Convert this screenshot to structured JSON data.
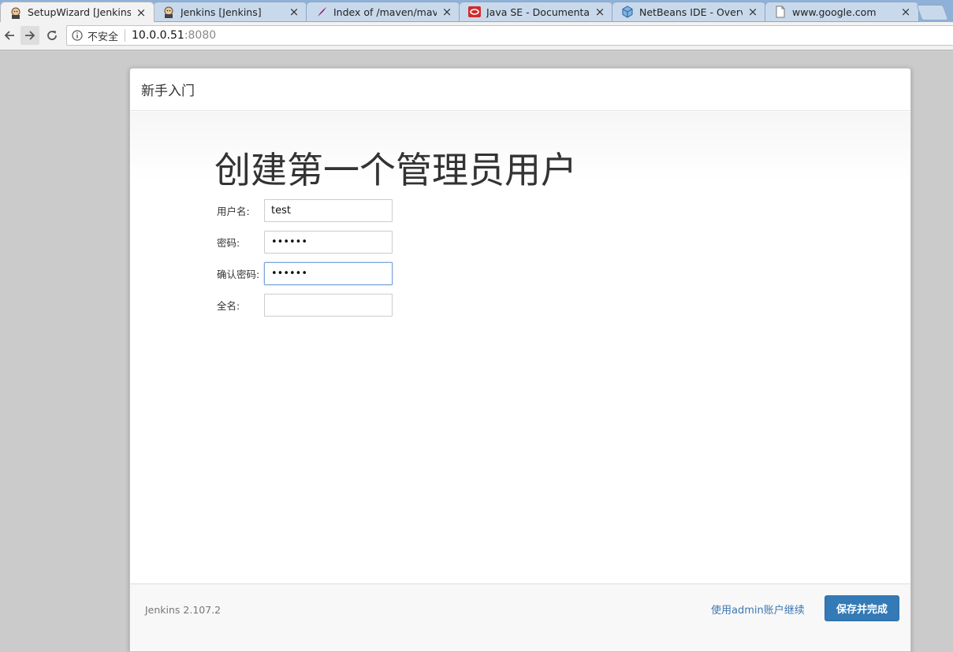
{
  "browser": {
    "tabs": [
      {
        "title": "SetupWizard [Jenkins]",
        "icon": "jenkins-icon",
        "active": true
      },
      {
        "title": "Jenkins [Jenkins]",
        "icon": "jenkins-icon",
        "active": false
      },
      {
        "title": "Index of /maven/maven",
        "icon": "feather-icon",
        "active": false
      },
      {
        "title": "Java SE - Documentation",
        "icon": "oracle-icon",
        "active": false
      },
      {
        "title": "NetBeans IDE - Overview",
        "icon": "netbeans-icon",
        "active": false
      },
      {
        "title": "www.google.com",
        "icon": "page-icon",
        "active": false
      }
    ],
    "close_glyph": "×",
    "address": {
      "security_label": "不安全",
      "host": "10.0.0.51",
      "port": ":8080"
    }
  },
  "page": {
    "header_title": "新手入门",
    "heading": "创建第一个管理员用户",
    "form": {
      "username_label": "用户名:",
      "username_value": "test",
      "password_label": "密码:",
      "password_value": "••••••",
      "confirm_label": "确认密码:",
      "confirm_value": "••••••",
      "fullname_label": "全名:",
      "fullname_value": ""
    },
    "footer": {
      "version": "Jenkins 2.107.2",
      "continue_as_admin": "使用admin账户继续",
      "save_button": "保存并完成"
    }
  },
  "colors": {
    "primary_button": "#337ab7",
    "link": "#3c76b2",
    "tabstrip": "#8fb1d8"
  }
}
